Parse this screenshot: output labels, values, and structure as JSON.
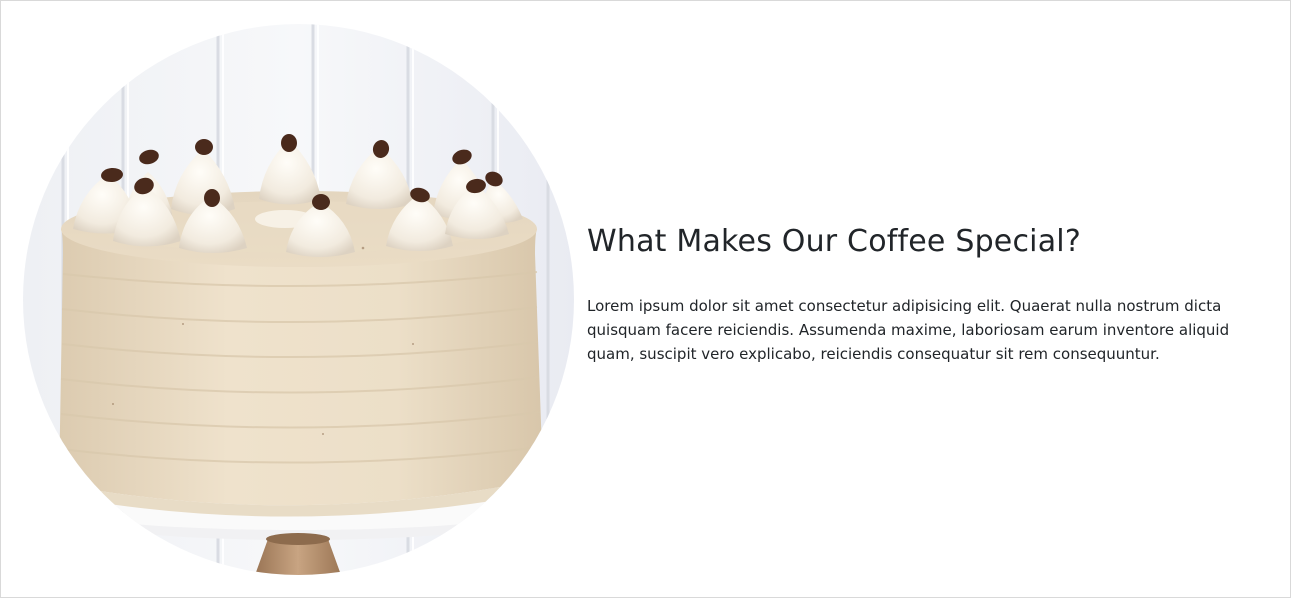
{
  "section": {
    "title": "What Makes Our Coffee Special?",
    "description": "Lorem ipsum dolor sit amet consectetur adipisicing elit. Quaerat nulla nostrum dicta quisquam facere reiciendis. Assumenda maxime, laboriosam earum inventore aliquid quam, suscipit vero explicabo, reiciendis consequatur sit rem consequuntur."
  },
  "image": {
    "subject": "coffee-cake",
    "icon": "cake-photo-icon"
  },
  "colors": {
    "frosting": "#eaddc7",
    "background_panel": "#f3f4f7",
    "bean": "#4a2a1c",
    "stand": "#b08a66"
  }
}
